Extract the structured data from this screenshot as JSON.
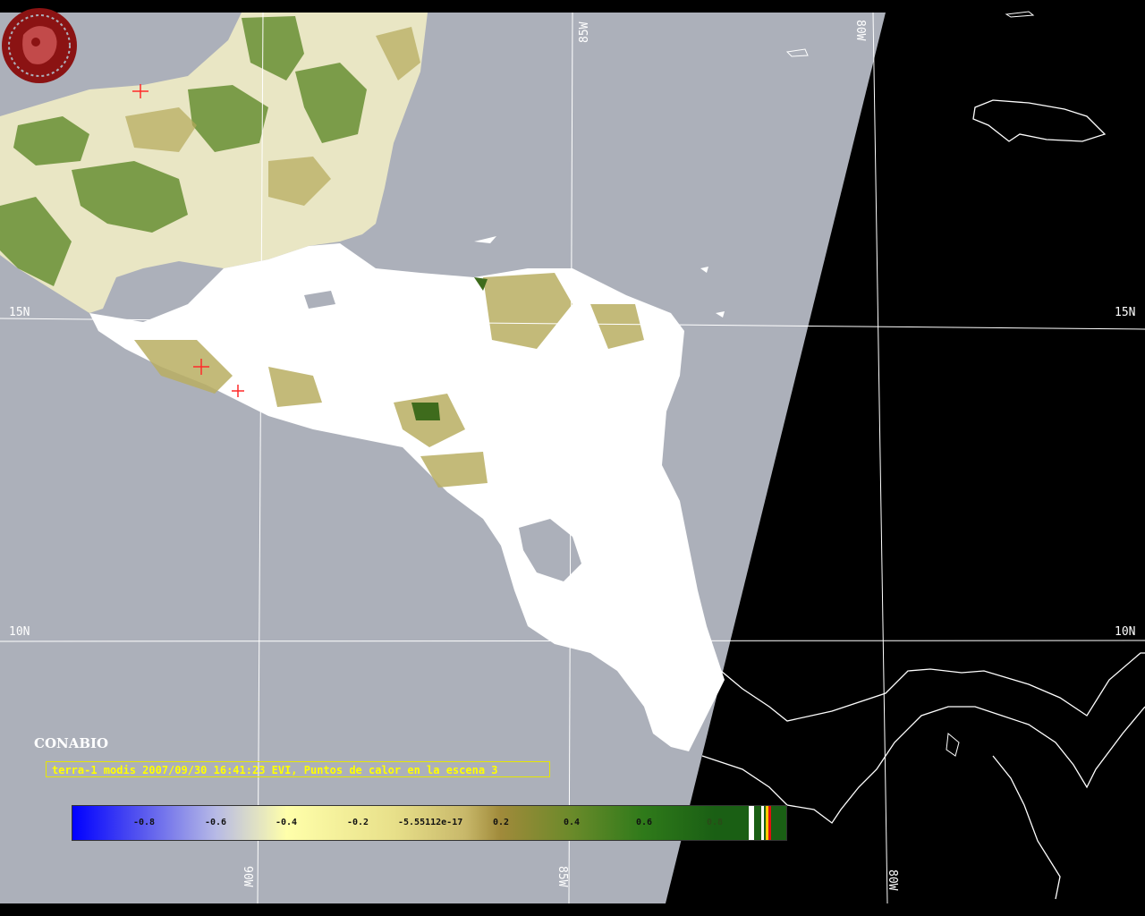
{
  "map": {
    "longitude_labels": {
      "w90": "90W",
      "w85": "85W",
      "w80": "80W"
    },
    "latitude_labels": {
      "n15": "15N",
      "n10": "10N"
    },
    "caption": "terra-1 modis 2007/09/30 16:41:23 EVI, Puntos de calor en la escena 3",
    "logo_text": "CONABIO",
    "colors": {
      "swath_background": "#acb0ba",
      "outside_swath": "#000000",
      "gridline": "#ffffff",
      "caption_text": "#ffff00",
      "hotspot_marker": "#ff2a2a"
    },
    "colorbar": {
      "ticks": [
        "-0.8",
        "-0.6",
        "-0.4",
        "-0.2",
        "-5.55112e-17",
        "0.2",
        "0.4",
        "0.6",
        "0.8"
      ]
    }
  }
}
